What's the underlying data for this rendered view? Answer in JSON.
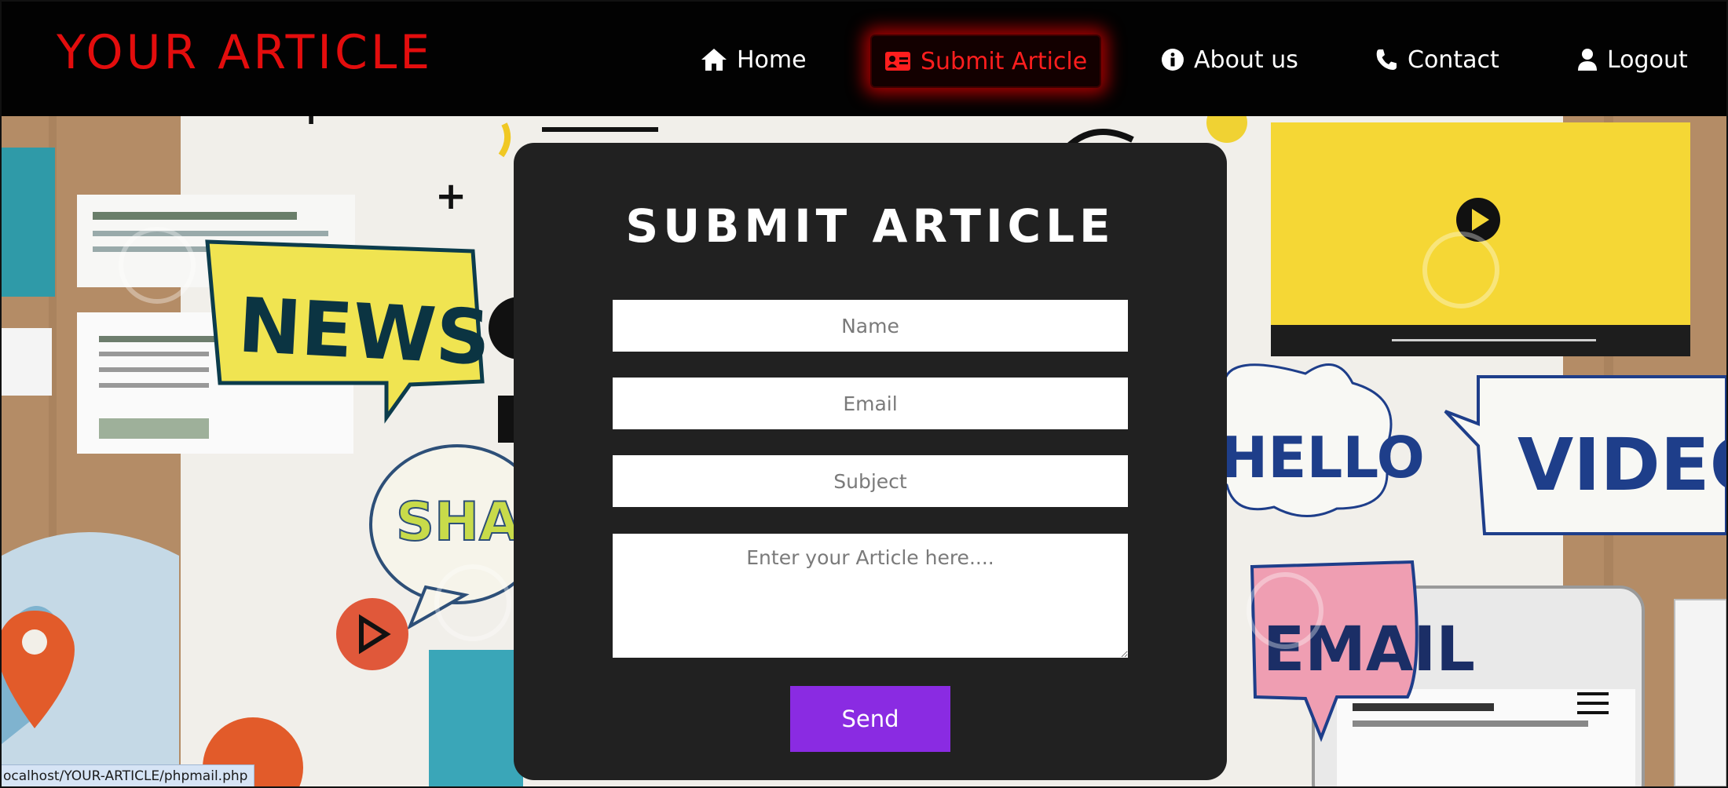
{
  "brand": {
    "title": "YOUR ARTICLE",
    "color": "#e30d0d"
  },
  "nav": {
    "items": [
      {
        "label": "Home",
        "icon": "home-icon"
      },
      {
        "label": "Submit Article",
        "icon": "id-card-icon",
        "active": true
      },
      {
        "label": "About us",
        "icon": "info-circle-icon"
      },
      {
        "label": "Contact",
        "icon": "phone-icon"
      },
      {
        "label": "Logout",
        "icon": "user-icon"
      }
    ],
    "active_color": "#ff1e1e"
  },
  "form": {
    "title": "SUBMIT ARTICLE",
    "name_placeholder": "Name",
    "email_placeholder": "Email",
    "subject_placeholder": "Subject",
    "article_placeholder": "Enter your Article here....",
    "send_label": "Send",
    "send_color": "#8a2be2"
  },
  "hero": {
    "collage_words": [
      "NEWS",
      "SHAR",
      "HELLO",
      "VIDEO",
      "EMAIL"
    ],
    "watermark_icon": "dreamstime-watermark-icon"
  },
  "status_bar": {
    "url": "ocalhost/YOUR-ARTICLE/phpmail.php"
  }
}
